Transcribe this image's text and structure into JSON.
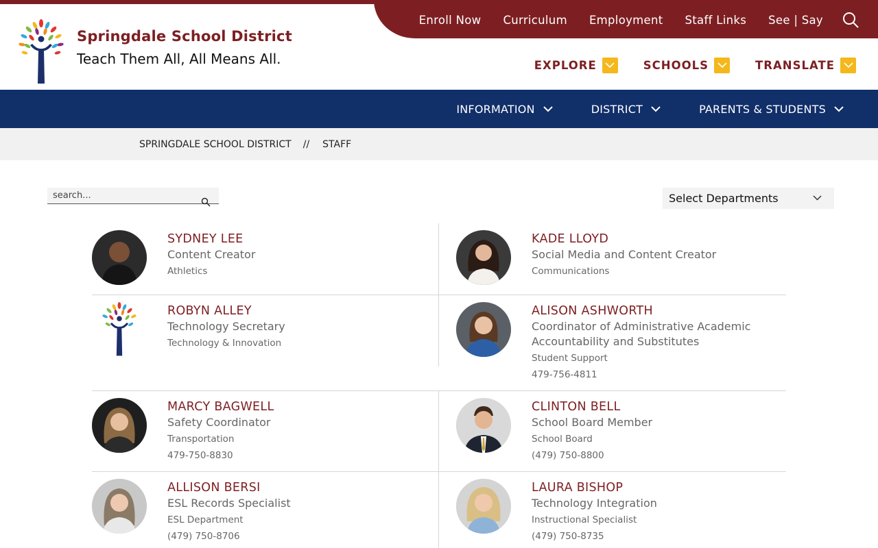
{
  "site": {
    "name": "Springdale School District",
    "tagline": "Teach Them All, All Means All.",
    "colors": {
      "maroon": "#7d1f22",
      "navy": "#112f69",
      "gold": "#f4b81c"
    }
  },
  "utility_nav": {
    "links": [
      "Enroll Now",
      "Curriculum",
      "Employment",
      "Staff Links",
      "See | Say"
    ],
    "search_icon": "search-icon"
  },
  "quick_nav": [
    "EXPLORE",
    "SCHOOLS",
    "TRANSLATE"
  ],
  "main_nav": [
    "INFORMATION",
    "DISTRICT",
    "PARENTS & STUDENTS"
  ],
  "breadcrumb": {
    "items": [
      "SPRINGDALE SCHOOL DISTRICT",
      "STAFF"
    ],
    "separator": "//"
  },
  "filters": {
    "search_placeholder": "search...",
    "department_select": "Select Departments"
  },
  "staff": [
    {
      "name": "SYDNEY LEE",
      "title": "Content Creator",
      "department": "Athletics",
      "phone": ""
    },
    {
      "name": "KADE LLOYD",
      "title": "Social Media and Content Creator",
      "department": "Communications",
      "phone": ""
    },
    {
      "name": "ROBYN ALLEY",
      "title": "Technology Secretary",
      "department": "Technology & Innovation",
      "phone": ""
    },
    {
      "name": "ALISON ASHWORTH",
      "title": "Coordinator of Administrative Academic Accountability and Substitutes",
      "department": "Student Support",
      "phone": "479-756-4811"
    },
    {
      "name": "MARCY BAGWELL",
      "title": "Safety Coordinator",
      "department": "Transportation",
      "phone": "479-750-8830"
    },
    {
      "name": "CLINTON BELL",
      "title": "School Board Member",
      "department": "School Board",
      "phone": "(479) 750-8800"
    },
    {
      "name": "ALLISON BERSI",
      "title": "ESL Records Specialist",
      "department": "ESL Department",
      "phone": "(479) 750-8706"
    },
    {
      "name": "LAURA BISHOP",
      "title": "Technology Integration",
      "department": "Instructional Specialist",
      "phone": "(479) 750-8735"
    }
  ]
}
